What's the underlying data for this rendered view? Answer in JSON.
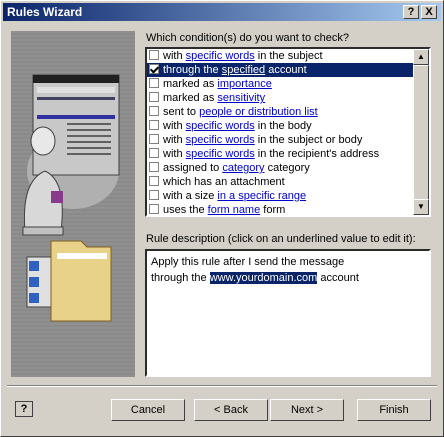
{
  "window": {
    "title": "Rules Wizard"
  },
  "titlebar_buttons": {
    "help": "?",
    "close": "X"
  },
  "conditions": {
    "prompt_pre": "Which condition(s) do you want to check?",
    "items": [
      {
        "pre": "with ",
        "link": "specific words",
        "post": " in the subject",
        "checked": false,
        "selected": false
      },
      {
        "pre": "through the ",
        "link": "specified",
        "post": " account",
        "checked": true,
        "selected": true
      },
      {
        "pre": "marked as ",
        "link": "importance",
        "post": "",
        "checked": false,
        "selected": false
      },
      {
        "pre": "marked as ",
        "link": "sensitivity",
        "post": "",
        "checked": false,
        "selected": false
      },
      {
        "pre": "sent to ",
        "link": "people or distribution list",
        "post": "",
        "checked": false,
        "selected": false
      },
      {
        "pre": "with ",
        "link": "specific words",
        "post": " in the body",
        "checked": false,
        "selected": false
      },
      {
        "pre": "with ",
        "link": "specific words",
        "post": " in the subject or body",
        "checked": false,
        "selected": false
      },
      {
        "pre": "with ",
        "link": "specific words",
        "post": " in the recipient's address",
        "checked": false,
        "selected": false
      },
      {
        "pre": "assigned to ",
        "link": "category",
        "post": " category",
        "checked": false,
        "selected": false
      },
      {
        "pre": "which has an attachment",
        "link": "",
        "post": "",
        "checked": false,
        "selected": false
      },
      {
        "pre": "with a size ",
        "link": "in a specific range",
        "post": "",
        "checked": false,
        "selected": false
      },
      {
        "pre": "uses the ",
        "link": "form name",
        "post": " form",
        "checked": false,
        "selected": false
      }
    ]
  },
  "description": {
    "label": "Rule description (click on an underlined value to edit it):",
    "line1": "Apply this rule after I send the message",
    "line2_pre": "through the ",
    "line2_value": "www.yourdomain.com",
    "line2_post": " account"
  },
  "buttons": {
    "cancel": "Cancel",
    "back": "< Back",
    "next": "Next >",
    "finish": "Finish"
  },
  "help_button": "?"
}
